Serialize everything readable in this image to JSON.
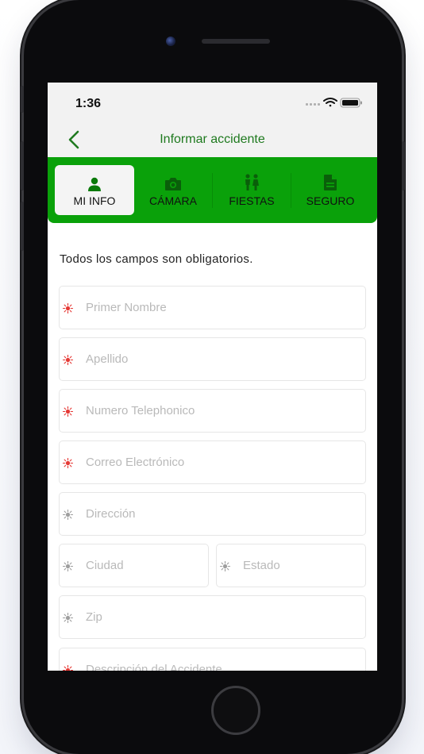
{
  "status": {
    "time": "1:36"
  },
  "nav": {
    "title": "Informar accidente",
    "back_icon": "chevron-left-icon"
  },
  "tabs": [
    {
      "label": "MI INFO",
      "icon": "person-icon",
      "active": true
    },
    {
      "label": "CÁMARA",
      "icon": "camera-icon",
      "active": false
    },
    {
      "label": "FIESTAS",
      "icon": "people-icon",
      "active": false
    },
    {
      "label": "SEGURO",
      "icon": "document-icon",
      "active": false
    }
  ],
  "note": "Todos los campos son obligatorios.",
  "fields": [
    {
      "placeholder": "Primer Nombre",
      "required": true
    },
    {
      "placeholder": "Apellido",
      "required": true
    },
    {
      "placeholder": "Numero Telephonico",
      "required": true
    },
    {
      "placeholder": "Correo Electrónico",
      "required": true
    },
    {
      "placeholder": "Dirección",
      "required": false
    },
    {
      "placeholder": "Ciudad",
      "required": false
    },
    {
      "placeholder": "Estado",
      "required": false
    },
    {
      "placeholder": "Zip",
      "required": false
    },
    {
      "placeholder": "Descripción del Accidente",
      "required": true
    }
  ],
  "colors": {
    "accent_green": "#0aa10a",
    "title_green": "#1f7a1f",
    "required_red": "#e53935",
    "optional_gray": "#9e9e9e"
  }
}
